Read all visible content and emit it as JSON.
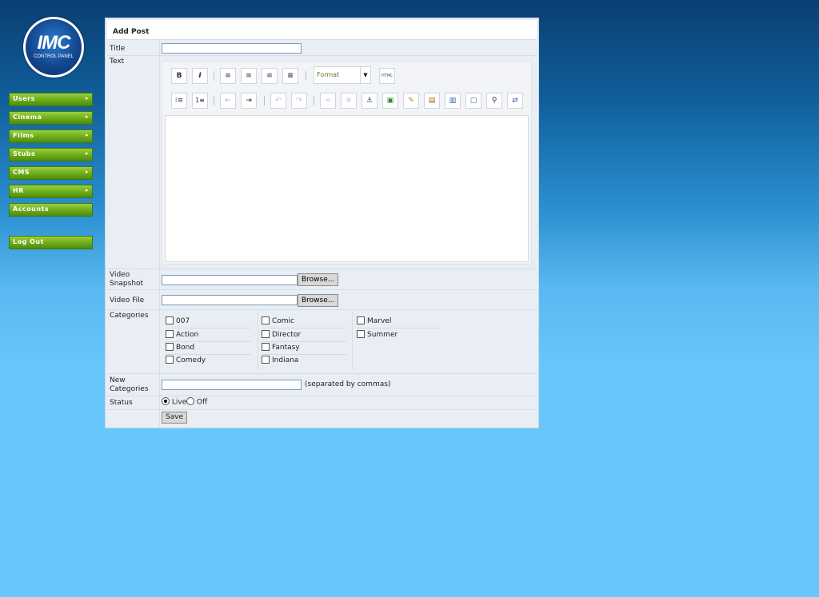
{
  "logo": {
    "main": "IMC",
    "sub": "CONTROL PANEL"
  },
  "menu": [
    {
      "label": "Users",
      "arrow": "▸"
    },
    {
      "label": "Cinema",
      "arrow": "▸"
    },
    {
      "label": "Films",
      "arrow": "▸"
    },
    {
      "label": "Stubs",
      "arrow": "▸"
    },
    {
      "label": "CMS",
      "arrow": "▸"
    },
    {
      "label": "HR",
      "arrow": "▸"
    },
    {
      "label": "Accounts"
    }
  ],
  "logout": {
    "label": "Log Out"
  },
  "form": {
    "title": "Add Post",
    "title_label": "Title",
    "title_value": "",
    "text_label": "Text",
    "editor": {
      "format_label": "Format",
      "html_label": "HTML",
      "icons": [
        "bold-icon",
        "italic-icon",
        "align-left-icon",
        "align-center-icon",
        "align-right-icon",
        "justify-icon",
        "bullet-list-icon",
        "numbered-list-icon",
        "outdent-icon",
        "indent-icon",
        "undo-icon",
        "redo-icon",
        "link-icon",
        "unlink-icon",
        "anchor-icon",
        "image-icon",
        "cleanup-icon",
        "paste-text-icon",
        "paste-word-icon",
        "select-all-icon",
        "find-icon",
        "replace-icon"
      ]
    },
    "video_snapshot_label": "Video Snapshot",
    "video_file_label": "Video File",
    "browse_label": "Browse...",
    "categories_label": "Categories",
    "categories": [
      [
        "007",
        "Action",
        "Bond",
        "Comedy"
      ],
      [
        "Comic",
        "Director",
        "Fantasy",
        "Indiana"
      ],
      [
        "Marvel",
        "Summer"
      ]
    ],
    "new_categories_label": "New Categories",
    "new_categories_hint": "(separated by commas)",
    "status_label": "Status",
    "status_options": [
      "Live",
      "Off"
    ],
    "status_selected": "Live",
    "save_label": "Save"
  }
}
